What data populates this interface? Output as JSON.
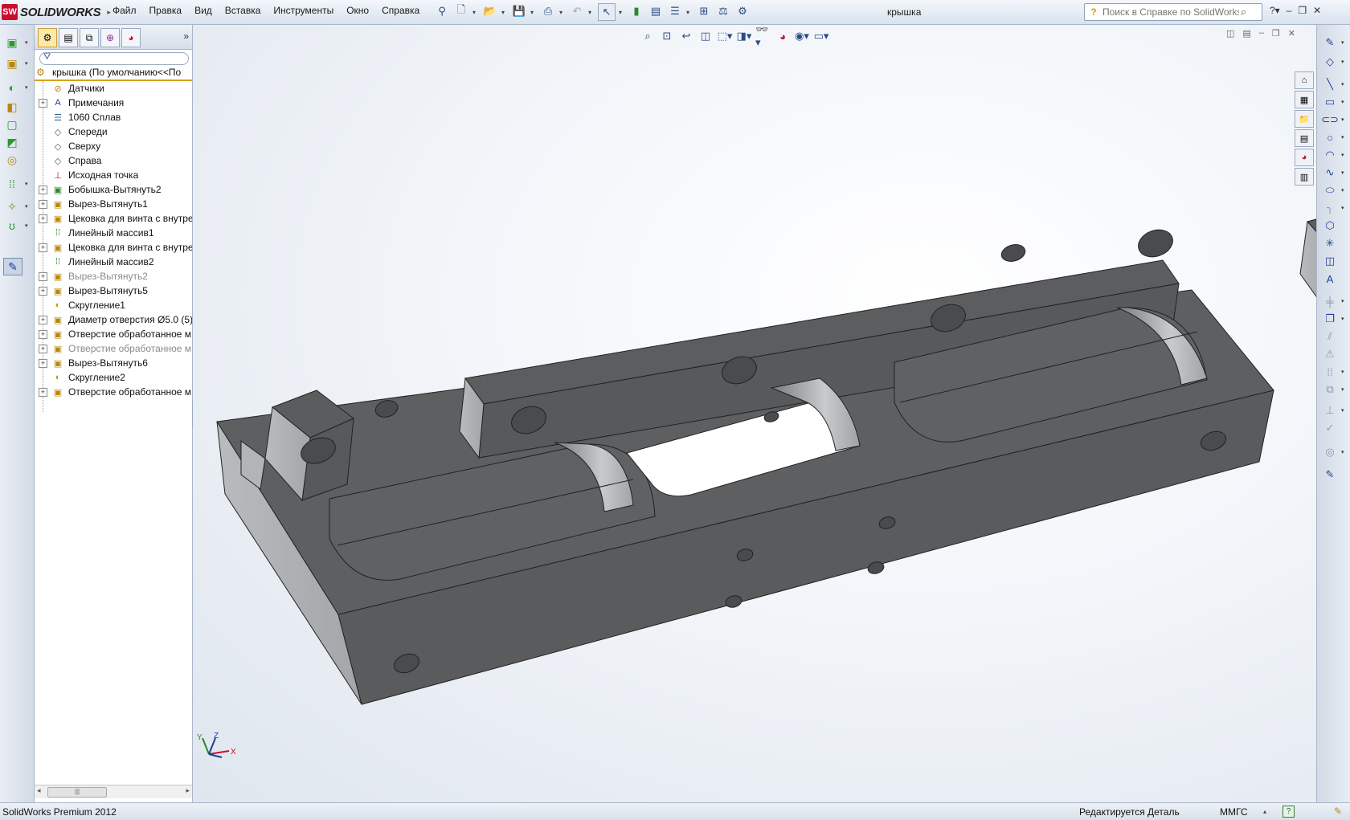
{
  "app": {
    "logo_ds": "SW",
    "logo_text": "SOLIDWORKS",
    "document_title": "крышка"
  },
  "menu": [
    "Файл",
    "Правка",
    "Вид",
    "Вставка",
    "Инструменты",
    "Окно",
    "Справка"
  ],
  "search": {
    "placeholder": "Поиск в Справке по SolidWorks"
  },
  "feature_manager": {
    "root_label": "крышка  (По умолчанию<<По",
    "tree": [
      {
        "label": "Датчики",
        "icon": "sensor-icon",
        "expandable": false,
        "dim": false
      },
      {
        "label": "Примечания",
        "icon": "annotations-icon",
        "expandable": true,
        "dim": false
      },
      {
        "label": "1060 Сплав",
        "icon": "material-icon",
        "expandable": false,
        "dim": false
      },
      {
        "label": "Спереди",
        "icon": "plane-icon",
        "expandable": false,
        "dim": false
      },
      {
        "label": "Сверху",
        "icon": "plane-icon",
        "expandable": false,
        "dim": false
      },
      {
        "label": "Справа",
        "icon": "plane-icon",
        "expandable": false,
        "dim": false
      },
      {
        "label": "Исходная точка",
        "icon": "origin-icon",
        "expandable": false,
        "dim": false
      },
      {
        "label": "Бобышка-Вытянуть2",
        "icon": "boss-extrude-icon",
        "expandable": true,
        "dim": false
      },
      {
        "label": "Вырез-Вытянуть1",
        "icon": "cut-extrude-icon",
        "expandable": true,
        "dim": false
      },
      {
        "label": "Цековка для винта с внутре",
        "icon": "hole-wizard-icon",
        "expandable": true,
        "dim": false
      },
      {
        "label": "Линейный массив1",
        "icon": "linear-pattern-icon",
        "expandable": false,
        "dim": false
      },
      {
        "label": "Цековка для винта с внутре",
        "icon": "hole-wizard-icon",
        "expandable": true,
        "dim": false
      },
      {
        "label": "Линейный массив2",
        "icon": "linear-pattern-icon",
        "expandable": false,
        "dim": false
      },
      {
        "label": "Вырез-Вытянуть2",
        "icon": "cut-extrude-icon",
        "expandable": true,
        "dim": true
      },
      {
        "label": "Вырез-Вытянуть5",
        "icon": "cut-extrude-icon",
        "expandable": true,
        "dim": false
      },
      {
        "label": "Скругление1",
        "icon": "fillet-icon",
        "expandable": false,
        "dim": false
      },
      {
        "label": "Диаметр отверстия Ø5.0 (5):",
        "icon": "hole-wizard-icon",
        "expandable": true,
        "dim": false
      },
      {
        "label": "Отверстие обработанное м",
        "icon": "hole-wizard-icon",
        "expandable": true,
        "dim": false
      },
      {
        "label": "Отверстие обработанное м",
        "icon": "hole-wizard-icon",
        "expandable": true,
        "dim": true
      },
      {
        "label": "Вырез-Вытянуть6",
        "icon": "cut-extrude-icon",
        "expandable": true,
        "dim": false
      },
      {
        "label": "Скругление2",
        "icon": "fillet-icon",
        "expandable": false,
        "dim": false
      },
      {
        "label": "Отверстие обработанное м",
        "icon": "hole-wizard-icon",
        "expandable": true,
        "dim": false
      }
    ]
  },
  "triad": {
    "x": "X",
    "y": "Y",
    "z": "Z"
  },
  "status": {
    "product": "SolidWorks Premium 2012",
    "mode": "Редактируется Деталь",
    "units": "ММГС",
    "help": "?"
  },
  "colors": {
    "part_face": "#5b5c5e",
    "part_side": "#a8aaad",
    "accent": "#d9a200"
  }
}
